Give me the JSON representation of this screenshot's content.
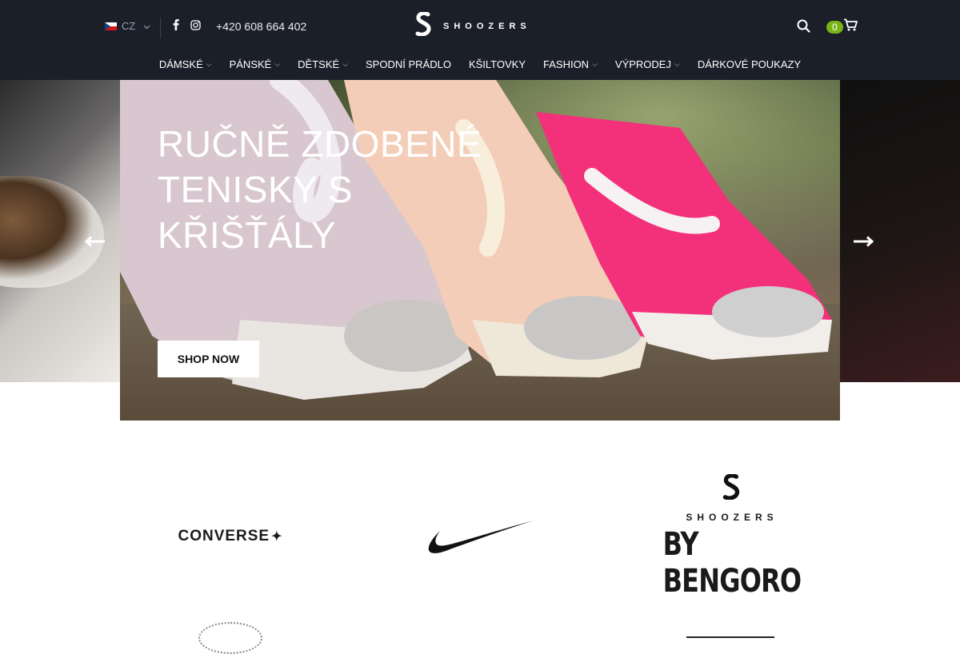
{
  "header": {
    "language": {
      "code": "CZ",
      "flag": "czech-flag-icon"
    },
    "social": [
      "facebook-icon",
      "instagram-icon"
    ],
    "phone": "+420 608 664 402",
    "logo_text": "SHOOZERS",
    "cart_count": "0"
  },
  "nav": {
    "items": [
      {
        "label": "DÁMSKÉ",
        "has_dropdown": true
      },
      {
        "label": "PÁNSKÉ",
        "has_dropdown": true
      },
      {
        "label": "DĚTSKÉ",
        "has_dropdown": true
      },
      {
        "label": "SPODNÍ PRÁDLO",
        "has_dropdown": false
      },
      {
        "label": "KŠILTOVKY",
        "has_dropdown": false
      },
      {
        "label": "FASHION",
        "has_dropdown": true
      },
      {
        "label": "VÝPRODEJ",
        "has_dropdown": true
      },
      {
        "label": "DÁRKOVÉ POUKAZY",
        "has_dropdown": false
      }
    ]
  },
  "hero": {
    "title": "RUČNĚ ZDOBENÉ TENISKY S KŘIŠŤÁLY",
    "button_label": "SHOP NOW"
  },
  "brands": {
    "converse": "CONVERSE",
    "shoozers_word": "SHOOZERS",
    "shoozers_by": "BY BENGORO"
  },
  "colors": {
    "header_bg": "#1b1f2a",
    "cart_badge": "#7ab317"
  }
}
